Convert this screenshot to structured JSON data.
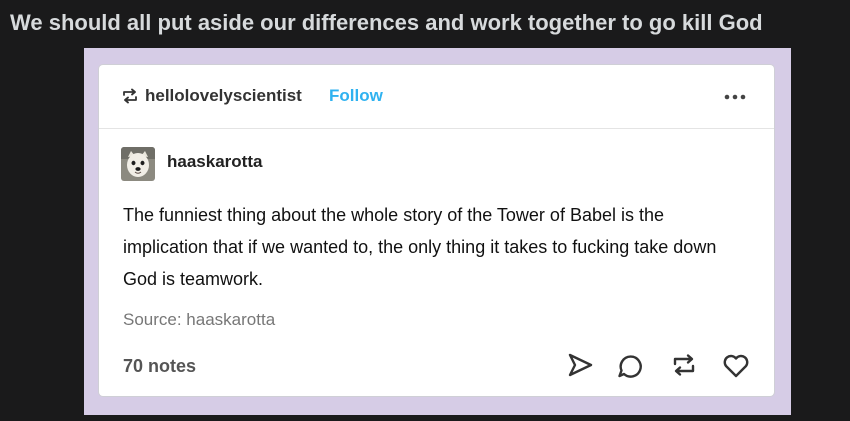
{
  "headline": "We should all put aside our differences and work together to go kill God",
  "colors": {
    "page_background": "#1a1a1b",
    "headline_text": "#d7dadc",
    "frame_background": "#d6cce6",
    "card_background": "#ffffff",
    "follow_accent": "#2fb2f0",
    "icon_stroke": "#333333"
  },
  "post": {
    "reblogger": {
      "icon": "reblog-icon",
      "username": "hellolovelyscientist",
      "follow_label": "Follow"
    },
    "menu_icon": "more-horizontal-icon",
    "author": {
      "avatar": "dog-avatar",
      "username": "haaskarotta"
    },
    "body": "The funniest thing about the whole story of the Tower of Babel is the implication that if we wanted to, the only thing it takes to fucking take down God is teamwork.",
    "source": "Source: haaskarotta",
    "notes": "70 notes",
    "action_icons": [
      "share-icon",
      "comment-icon",
      "reblog-icon",
      "like-heart-icon"
    ]
  }
}
